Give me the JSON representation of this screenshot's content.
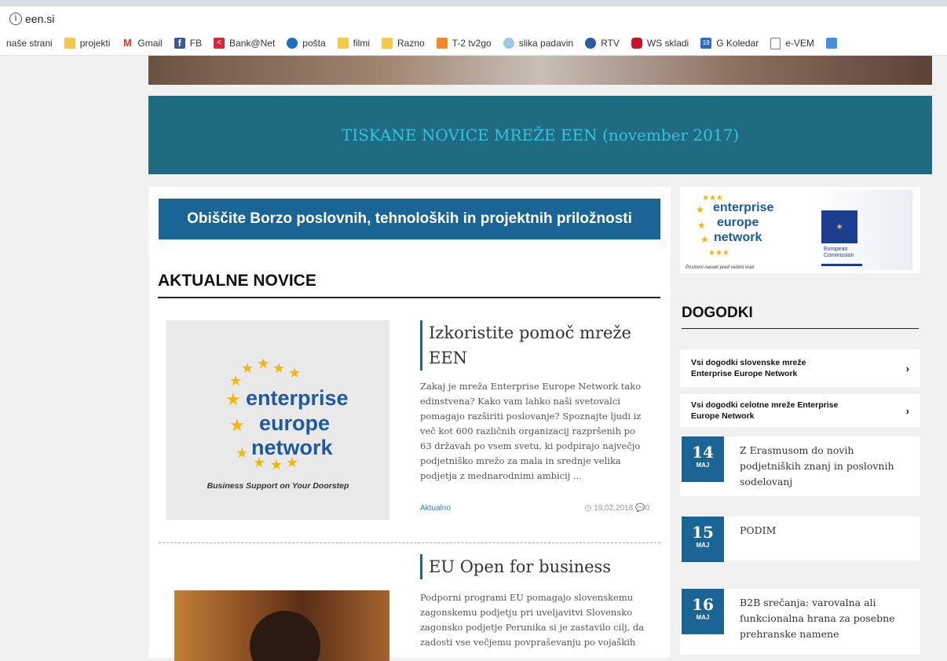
{
  "browser": {
    "url": "een.si",
    "bookmarks": [
      {
        "label": "naše strani",
        "icon": "none"
      },
      {
        "label": "projekti",
        "icon": "folder"
      },
      {
        "label": "Gmail",
        "icon": "gmail"
      },
      {
        "label": "FB",
        "icon": "fb"
      },
      {
        "label": "Bank@Net",
        "icon": "bank"
      },
      {
        "label": "pošta",
        "icon": "posta"
      },
      {
        "label": "filmi",
        "icon": "folder"
      },
      {
        "label": "Razno",
        "icon": "folder"
      },
      {
        "label": "T-2 tv2go",
        "icon": "tv"
      },
      {
        "label": "slika padavin",
        "icon": "rain"
      },
      {
        "label": "RTV",
        "icon": "rtv"
      },
      {
        "label": "WS skladi",
        "icon": "ws"
      },
      {
        "label": "G Koledar",
        "icon": "cal"
      },
      {
        "label": "e-VEM",
        "icon": "doc"
      }
    ]
  },
  "banner": {
    "title": "TISKANE NOVICE MREŽE EEN (november 2017)"
  },
  "borza": {
    "label": "Obiščite Borzo poslovnih, tehnoloških in projektnih priložnosti"
  },
  "news": {
    "section_title": "AKTUALNE NOVICE",
    "logo": {
      "w1": "enterprise",
      "w2": "europe",
      "w3": "network",
      "tagline": "Business Support on Your Doorstep"
    },
    "articles": [
      {
        "title": "Izkoristite pomoč mreže EEN",
        "excerpt": "Zakaj je mreža Enterprise Europe Network tako edinstvena? Kako vam lahko naši svetovalci pomagajo razširiti poslovanje? Spoznajte ljudi iz več kot 600 različnih organizacij razpršenih po 63 državah po vsem svetu, ki podpirajo največjo podjetniško mrežo za mala in srednje velika podjetja z mednarodnimi ambicij ...",
        "category": "Aktualno",
        "date": "19.02.2018",
        "comments": "0"
      },
      {
        "title": "EU Open for business",
        "excerpt": "Podporni programi EU pomagajo slovenskemu zagonskemu podjetju pri uveljavitvi Slovensko zagonsko podjetje Perunika si je zastavilo cilj, da zadosti vse večjemu povpraševanju po vojaških"
      }
    ]
  },
  "sidebar": {
    "een_logo": {
      "w1": "enterprise",
      "w2": "europe",
      "w3": "network",
      "tagline": "Poslovni nasvet pred vašimi vrati"
    },
    "ec_logo": {
      "line1": "European",
      "line2": "Commission"
    },
    "events_title": "DOGODKI",
    "links": [
      {
        "label": "Vsi dogodki slovenske mreže Enterprise Europe Network"
      },
      {
        "label": "Vsi dogodki celotne mreže Enterprise Europe Network"
      }
    ],
    "events": [
      {
        "day": "14",
        "month": "MAJ",
        "title": "Z Erasmusom do novih podjetniških znanj in poslovnih sodelovanj"
      },
      {
        "day": "15",
        "month": "MAJ",
        "title": "PODIM"
      },
      {
        "day": "16",
        "month": "MAJ",
        "title": "B2B srečanja: varovalna ali funkcionalna hrana za posebne prehranske namene"
      }
    ]
  }
}
